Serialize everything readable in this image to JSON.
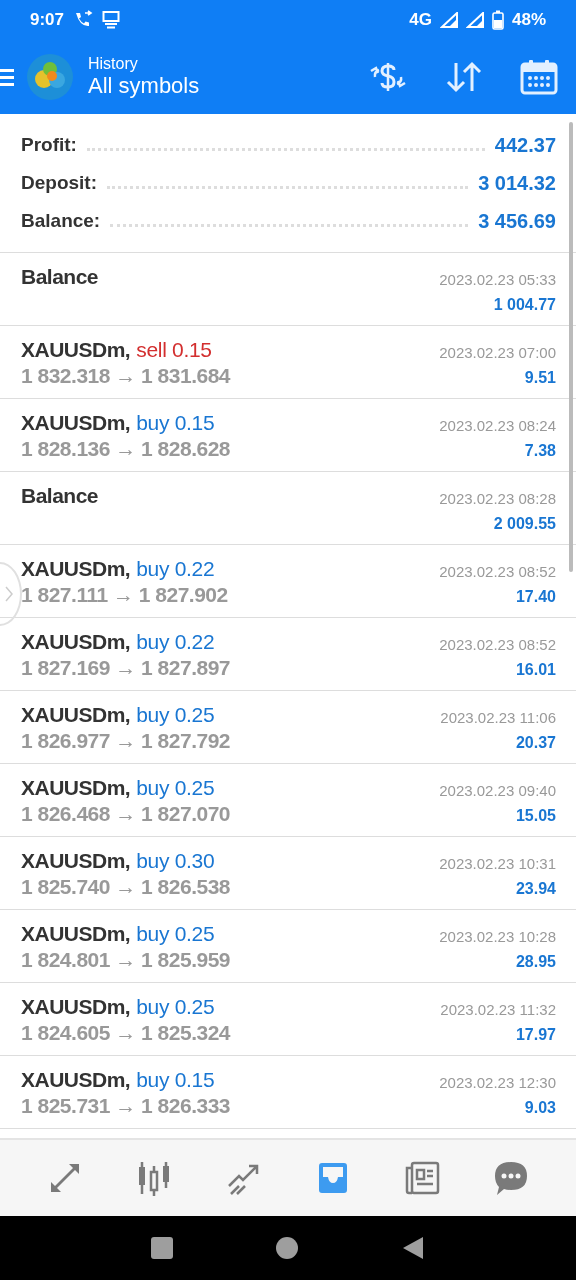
{
  "status_bar": {
    "time": "9:07",
    "network": "4G",
    "battery": "48%"
  },
  "header": {
    "subtitle": "History",
    "title": "All symbols"
  },
  "summary": [
    {
      "label": "Profit:",
      "value": "442.37"
    },
    {
      "label": "Deposit:",
      "value": "3 014.32"
    },
    {
      "label": "Balance:",
      "value": "3 456.69"
    }
  ],
  "rows": [
    {
      "kind": "balance",
      "title": "Balance",
      "time": "2023.02.23 05:33",
      "amount": "1 004.77"
    },
    {
      "kind": "deal",
      "symbol": "XAUUSDm,",
      "order": "sell 0.15",
      "color": "#d32f2f",
      "prices": "1 832.318 → 1 831.684",
      "time": "2023.02.23 07:00",
      "amount": "9.51"
    },
    {
      "kind": "deal",
      "symbol": "XAUUSDm,",
      "order": "buy 0.15",
      "color": "#1976d2",
      "prices": "1 828.136 → 1 828.628",
      "time": "2023.02.23 08:24",
      "amount": "7.38"
    },
    {
      "kind": "balance",
      "title": "Balance",
      "time": "2023.02.23 08:28",
      "amount": "2 009.55"
    },
    {
      "kind": "deal",
      "symbol": "XAUUSDm,",
      "order": "buy 0.22",
      "color": "#1976d2",
      "prices": "1 827.111 → 1 827.902",
      "time": "2023.02.23 08:52",
      "amount": "17.40"
    },
    {
      "kind": "deal",
      "symbol": "XAUUSDm,",
      "order": "buy 0.22",
      "color": "#1976d2",
      "prices": "1 827.169 → 1 827.897",
      "time": "2023.02.23 08:52",
      "amount": "16.01"
    },
    {
      "kind": "deal",
      "symbol": "XAUUSDm,",
      "order": "buy 0.25",
      "color": "#1976d2",
      "prices": "1 826.977 → 1 827.792",
      "time": "2023.02.23 11:06",
      "amount": "20.37"
    },
    {
      "kind": "deal",
      "symbol": "XAUUSDm,",
      "order": "buy 0.25",
      "color": "#1976d2",
      "prices": "1 826.468 → 1 827.070",
      "time": "2023.02.23 09:40",
      "amount": "15.05"
    },
    {
      "kind": "deal",
      "symbol": "XAUUSDm,",
      "order": "buy 0.30",
      "color": "#1976d2",
      "prices": "1 825.740 → 1 826.538",
      "time": "2023.02.23 10:31",
      "amount": "23.94"
    },
    {
      "kind": "deal",
      "symbol": "XAUUSDm,",
      "order": "buy 0.25",
      "color": "#1976d2",
      "prices": "1 824.801 → 1 825.959",
      "time": "2023.02.23 10:28",
      "amount": "28.95"
    },
    {
      "kind": "deal",
      "symbol": "XAUUSDm,",
      "order": "buy 0.25",
      "color": "#1976d2",
      "prices": "1 824.605 → 1 825.324",
      "time": "2023.02.23 11:32",
      "amount": "17.97"
    },
    {
      "kind": "deal",
      "symbol": "XAUUSDm,",
      "order": "buy 0.15",
      "color": "#1976d2",
      "prices": "1 825.731 → 1 826.333",
      "time": "2023.02.23 12:30",
      "amount": "9.03"
    }
  ],
  "bottom_nav": [
    {
      "selected": false
    },
    {
      "selected": false
    },
    {
      "selected": false
    },
    {
      "selected": true
    },
    {
      "selected": false
    },
    {
      "selected": false
    }
  ]
}
